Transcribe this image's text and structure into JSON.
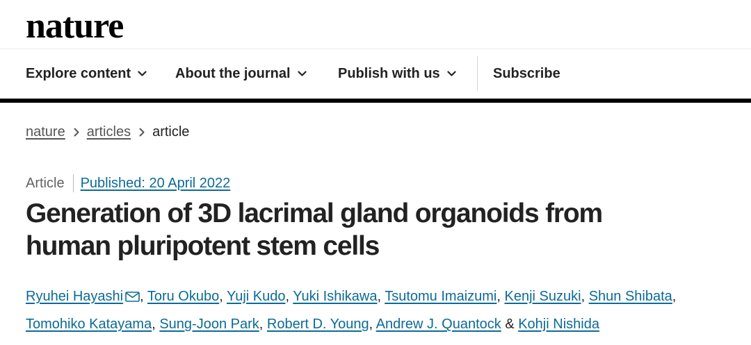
{
  "header": {
    "logo": "nature"
  },
  "nav": {
    "items": [
      {
        "label": "Explore content",
        "has_dropdown": true,
        "icon": "chevron-down-icon"
      },
      {
        "label": "About the journal",
        "has_dropdown": true,
        "icon": "chevron-down-icon"
      },
      {
        "label": "Publish with us",
        "has_dropdown": true,
        "icon": "chevron-down-icon"
      },
      {
        "label": "Subscribe",
        "has_dropdown": false
      }
    ]
  },
  "breadcrumb": {
    "items": [
      "nature",
      "articles"
    ],
    "current": "article",
    "separator_icon": "chevron-right-icon"
  },
  "article": {
    "type": "Article",
    "published": "Published: 20 April 2022",
    "title_line1": "Generation of 3D lacrimal gland organoids from",
    "title_line2": "human pluripotent stem cells",
    "authors": [
      {
        "name": "Ryuhei Hayashi",
        "corresponding": true,
        "icon": "mail-icon"
      },
      {
        "name": "Toru Okubo"
      },
      {
        "name": "Yuji Kudo"
      },
      {
        "name": "Yuki Ishikawa"
      },
      {
        "name": "Tsutomu Imaizumi"
      },
      {
        "name": "Kenji Suzuki"
      },
      {
        "name": "Shun Shibata"
      },
      {
        "name": "Tomohiko Katayama"
      },
      {
        "name": "Sung-Joon Park"
      },
      {
        "name": "Robert D. Young"
      },
      {
        "name": "Andrew J. Quantock"
      },
      {
        "name": "Kohji Nishida"
      }
    ],
    "author_separator": ", ",
    "last_author_joiner": " & "
  },
  "colors": {
    "link": "#0b6a96",
    "text": "#222222",
    "muted": "#626262",
    "bar": "#000000"
  }
}
